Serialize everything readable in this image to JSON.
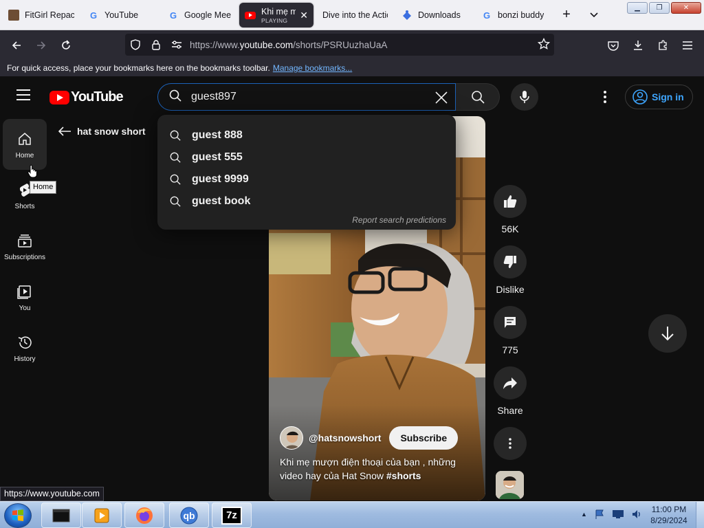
{
  "browser": {
    "tabs": [
      {
        "title": "FitGirl Repacks",
        "icon": "fitgirl-favicon"
      },
      {
        "title": "YouTube",
        "icon": "google-favicon"
      },
      {
        "title": "Google Meet",
        "icon": "google-favicon"
      },
      {
        "title": "Khi mẹ mượn",
        "subtitle": "PLAYING",
        "icon": "youtube-favicon",
        "active": true
      },
      {
        "title": "Dive into the Action",
        "icon": "none"
      },
      {
        "title": "Downloads",
        "icon": "puzzle-favicon"
      },
      {
        "title": "bonzi buddy",
        "icon": "google-favicon"
      }
    ],
    "url_prefix": "https://www.",
    "url_host": "youtube.com",
    "url_path": "/shorts/PSRUuzhaUaA",
    "bookmarks_hint": "For quick access, place your bookmarks here on the bookmarks toolbar.",
    "bookmarks_link": "Manage bookmarks...",
    "status_url": "https://www.youtube.com"
  },
  "youtube": {
    "logo_text": "YouTube",
    "search_value": "guest897",
    "signin_label": "Sign in",
    "suggestions": [
      "guest 888",
      "guest 555",
      "guest 9999",
      "guest book"
    ],
    "report_label": "Report search predictions",
    "guide": [
      {
        "label": "Home",
        "icon": "home-icon"
      },
      {
        "label": "Shorts",
        "icon": "shorts-icon"
      },
      {
        "label": "Subscriptions",
        "icon": "subscriptions-icon"
      },
      {
        "label": "You",
        "icon": "you-icon"
      },
      {
        "label": "History",
        "icon": "history-icon"
      }
    ],
    "tooltip": "Home",
    "back_title": "hat snow short",
    "channel": "@hatsnowshort",
    "subscribe_label": "Subscribe",
    "caption_text": "Khi mẹ mượn điện thoại của bạn , những video hay của Hat Snow ",
    "caption_tag": "#shorts",
    "actions": {
      "likes": "56K",
      "dislike": "Dislike",
      "comments": "775",
      "share": "Share"
    }
  },
  "taskbar": {
    "time": "11:00 PM",
    "date": "8/29/2024",
    "apps": [
      "windows-explorer",
      "media-player",
      "firefox",
      "qbittorrent",
      "7-zip"
    ],
    "app_labels": {
      "qb": "qb",
      "sevenzip": "7z"
    }
  },
  "colors": {
    "accent": "#3ea6ff",
    "youtube_red": "#ff0000",
    "search_border": "#1c62b9"
  }
}
